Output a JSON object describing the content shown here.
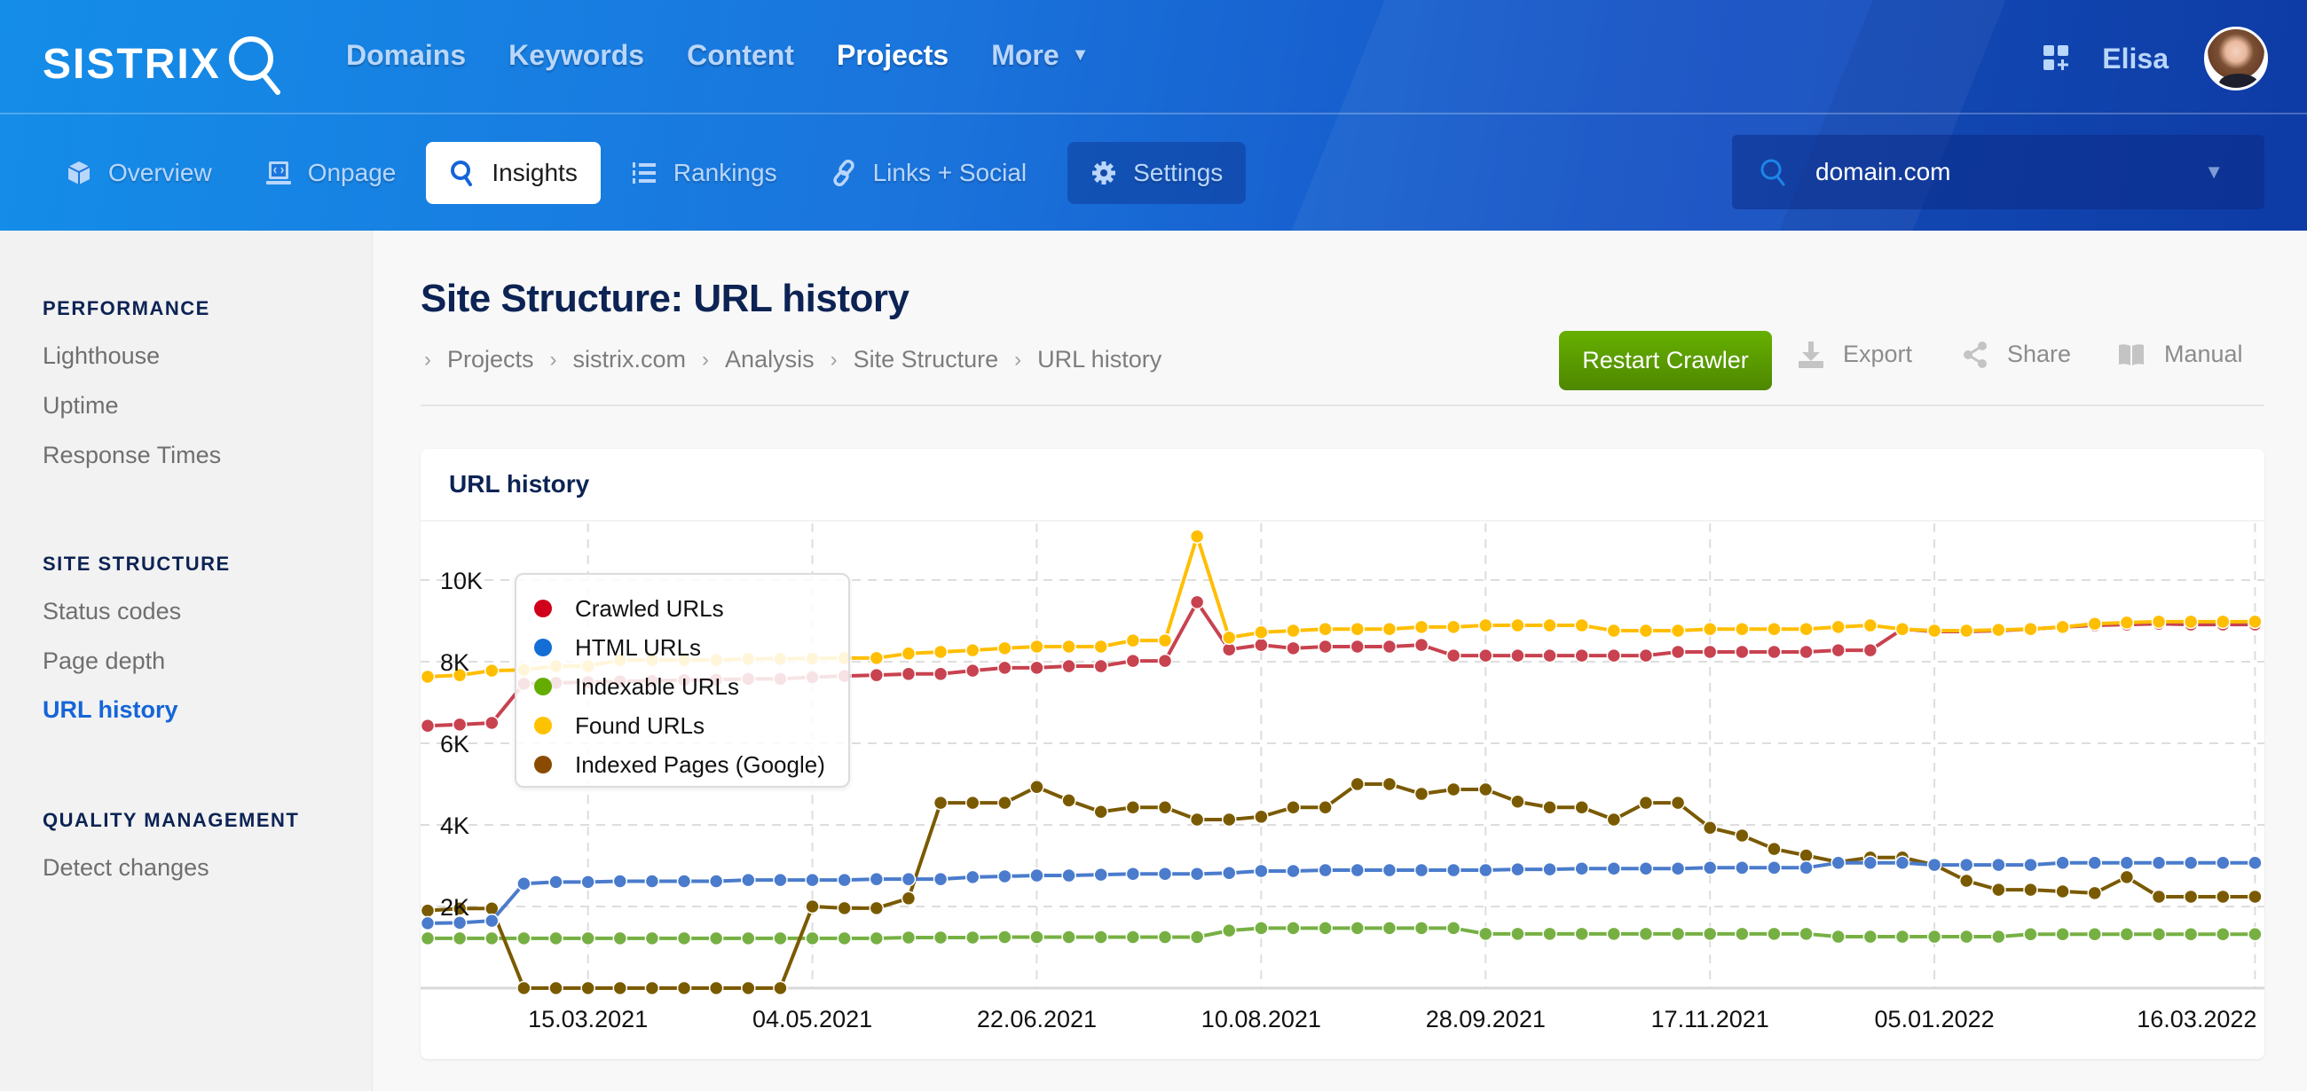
{
  "header": {
    "logo": "SISTRIX",
    "nav": [
      {
        "label": "Domains",
        "active": false
      },
      {
        "label": "Keywords",
        "active": false
      },
      {
        "label": "Content",
        "active": false
      },
      {
        "label": "Projects",
        "active": true
      },
      {
        "label": "More",
        "active": false
      }
    ],
    "user_name": "Elisa",
    "apps_icon": "apps-add-icon"
  },
  "subnav": {
    "tabs": [
      {
        "label": "Overview",
        "icon": "cube-icon"
      },
      {
        "label": "Onpage",
        "icon": "monitor-code-icon"
      },
      {
        "label": "Insights",
        "icon": "search-icon",
        "active": true
      },
      {
        "label": "Rankings",
        "icon": "ordered-list-icon"
      },
      {
        "label": "Links + Social",
        "icon": "link-icon"
      },
      {
        "label": "Settings",
        "icon": "gear-icon"
      }
    ],
    "domain_select": {
      "value": "domain.com"
    }
  },
  "sidebar": {
    "sections": [
      {
        "title": "PERFORMANCE",
        "items": [
          {
            "label": "Lighthouse"
          },
          {
            "label": "Uptime"
          },
          {
            "label": "Response Times"
          }
        ]
      },
      {
        "title": "SITE STRUCTURE",
        "items": [
          {
            "label": "Status codes"
          },
          {
            "label": "Page depth"
          },
          {
            "label": "URL history",
            "active": true
          }
        ]
      },
      {
        "title": "QUALITY MANAGEMENT",
        "items": [
          {
            "label": "Detect changes"
          }
        ]
      }
    ]
  },
  "page": {
    "title": "Site Structure: URL history",
    "breadcrumb": [
      "Projects",
      "sistrix.com",
      "Analysis",
      "Site Structure",
      "URL history"
    ],
    "actions": {
      "restart": "Restart Crawler",
      "export": "Export",
      "share": "Share",
      "manual": "Manual"
    }
  },
  "card": {
    "title": "URL history"
  },
  "colors": {
    "crawled": "#c8424f",
    "html": "#4a7bcc",
    "indexable": "#76b043",
    "found": "#ffbe00",
    "indexed": "#7a5a00",
    "legend_crawled": "#d0021b",
    "legend_html": "#136ed6",
    "legend_indexable": "#64ad00",
    "legend_found": "#ffc200",
    "legend_indexed": "#8b4a02",
    "restart_button": "#5a9c00",
    "primary_blue": "#1565d8"
  },
  "chart_data": {
    "type": "line",
    "title": "URL history",
    "xlabel": "",
    "ylabel": "",
    "ylim": [
      0,
      11500
    ],
    "yticks": [
      {
        "value": 2000,
        "label": "2K"
      },
      {
        "value": 4000,
        "label": "4K"
      },
      {
        "value": 6000,
        "label": "6K"
      },
      {
        "value": 8000,
        "label": "8K"
      },
      {
        "value": 10000,
        "label": "10K"
      }
    ],
    "x_count": 58,
    "xticks": [
      {
        "index": 5,
        "label": "15.03.2021"
      },
      {
        "index": 12,
        "label": "04.05.2021"
      },
      {
        "index": 19,
        "label": "22.06.2021"
      },
      {
        "index": 26,
        "label": "10.08.2021"
      },
      {
        "index": 33,
        "label": "28.09.2021"
      },
      {
        "index": 40,
        "label": "17.11.2021"
      },
      {
        "index": 47,
        "label": "05.01.2022"
      },
      {
        "index": 57,
        "label": "16.03.2022"
      }
    ],
    "grid": true,
    "legend_position": "top-left",
    "series": [
      {
        "name": "Crawled URLs",
        "key": "crawled",
        "values": [
          6430,
          6460,
          6500,
          7460,
          7480,
          7500,
          7520,
          7530,
          7550,
          7560,
          7580,
          7580,
          7620,
          7650,
          7670,
          7700,
          7700,
          7780,
          7850,
          7850,
          7890,
          7890,
          8020,
          8020,
          9460,
          8300,
          8410,
          8330,
          8370,
          8370,
          8370,
          8410,
          8150,
          8150,
          8150,
          8150,
          8150,
          8150,
          8150,
          8240,
          8240,
          8240,
          8240,
          8240,
          8280,
          8280,
          8800,
          8740,
          8740,
          8760,
          8800,
          8850,
          8890,
          8910,
          8930,
          8910,
          8910,
          8910
        ]
      },
      {
        "name": "HTML URLs",
        "key": "html",
        "values": [
          1590,
          1600,
          1650,
          2560,
          2600,
          2600,
          2620,
          2620,
          2620,
          2620,
          2650,
          2650,
          2650,
          2650,
          2670,
          2670,
          2670,
          2720,
          2740,
          2760,
          2760,
          2780,
          2800,
          2800,
          2800,
          2820,
          2870,
          2870,
          2890,
          2890,
          2890,
          2890,
          2890,
          2890,
          2910,
          2910,
          2930,
          2930,
          2930,
          2930,
          2950,
          2950,
          2950,
          2950,
          3070,
          3070,
          3070,
          3020,
          3020,
          3020,
          3020,
          3070,
          3070,
          3070,
          3070,
          3070,
          3070,
          3070
        ]
      },
      {
        "name": "Indexable URLs",
        "key": "indexable",
        "values": [
          1220,
          1220,
          1220,
          1220,
          1220,
          1220,
          1220,
          1220,
          1220,
          1220,
          1220,
          1220,
          1220,
          1220,
          1220,
          1240,
          1240,
          1240,
          1250,
          1250,
          1250,
          1250,
          1250,
          1250,
          1250,
          1410,
          1470,
          1470,
          1470,
          1470,
          1470,
          1470,
          1470,
          1330,
          1330,
          1330,
          1330,
          1330,
          1330,
          1330,
          1330,
          1330,
          1330,
          1330,
          1260,
          1260,
          1260,
          1260,
          1260,
          1260,
          1320,
          1320,
          1320,
          1320,
          1320,
          1320,
          1320,
          1320
        ]
      },
      {
        "name": "Found URLs",
        "key": "found",
        "values": [
          7630,
          7670,
          7780,
          7800,
          7890,
          7890,
          8040,
          8040,
          8040,
          8040,
          8070,
          8070,
          8080,
          8090,
          8090,
          8200,
          8240,
          8280,
          8330,
          8370,
          8370,
          8370,
          8520,
          8520,
          11070,
          8590,
          8720,
          8760,
          8800,
          8800,
          8800,
          8850,
          8850,
          8890,
          8890,
          8890,
          8890,
          8760,
          8760,
          8760,
          8800,
          8800,
          8800,
          8800,
          8850,
          8890,
          8800,
          8760,
          8760,
          8780,
          8800,
          8850,
          8930,
          8960,
          8980,
          8980,
          8980,
          8980
        ]
      },
      {
        "name": "Indexed Pages (Google)",
        "key": "indexed",
        "values": [
          1900,
          1950,
          1950,
          0,
          0,
          0,
          0,
          0,
          0,
          0,
          0,
          0,
          2000,
          1960,
          1960,
          2200,
          4540,
          4540,
          4540,
          4930,
          4600,
          4320,
          4430,
          4430,
          4130,
          4130,
          4200,
          4430,
          4430,
          5000,
          5000,
          4760,
          4870,
          4870,
          4570,
          4430,
          4430,
          4130,
          4540,
          4540,
          3930,
          3740,
          3410,
          3250,
          3090,
          3200,
          3200,
          3020,
          2630,
          2410,
          2410,
          2370,
          2330,
          2720,
          2240,
          2240,
          2240,
          2240
        ]
      }
    ]
  }
}
